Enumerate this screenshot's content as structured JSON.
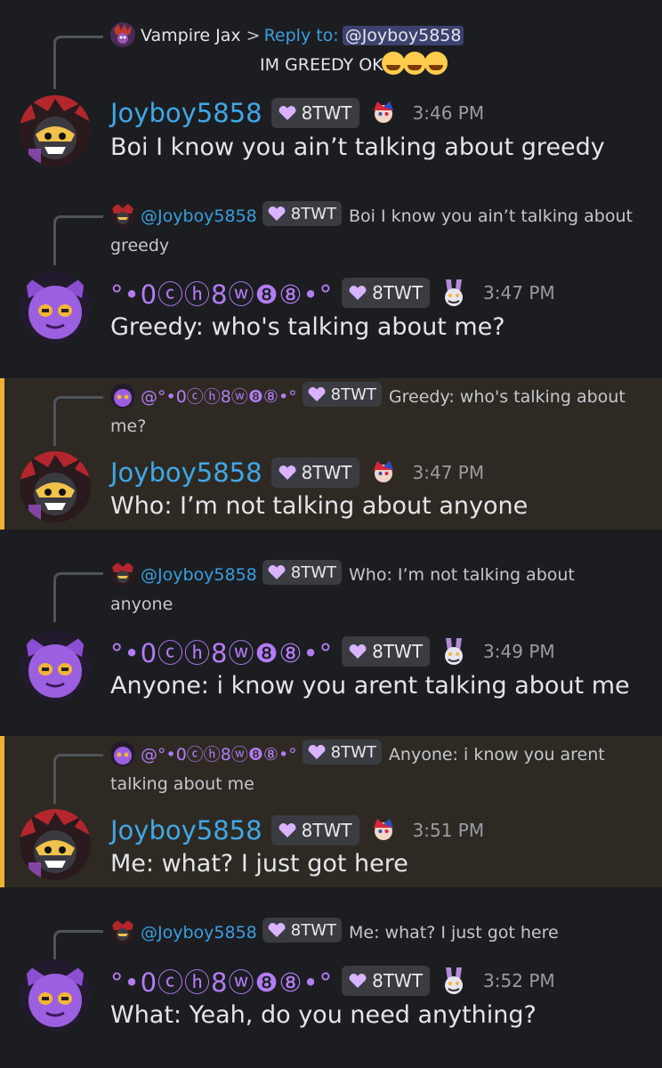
{
  "messages": [
    {
      "reply": {
        "author": "Vampire Jax",
        "arrow": ">",
        "prefix": "Reply to:",
        "mention": "@Joyboy5858",
        "text": "IM GREEDY OK"
      },
      "author": "Joyboy5858",
      "tag": "8TWT",
      "time": "3:46 PM",
      "text": "Boi I know you ain’t talking about greedy",
      "highlighted": false
    },
    {
      "reply": {
        "author": "@Joyboy5858",
        "tag": "8TWT",
        "text": "Boi I know you ain’t talking about greedy"
      },
      "author": "°•0ⓒⓗ8ⓦ❽⑧•°",
      "tag": "8TWT",
      "time": "3:47 PM",
      "text": "Greedy: who's talking about me?",
      "highlighted": false
    },
    {
      "reply": {
        "author": "@°•0ⓒⓗ8ⓦ❽⑧•°",
        "tag": "8TWT",
        "text": "Greedy: who's talking about me?"
      },
      "author": "Joyboy5858",
      "tag": "8TWT",
      "time": "3:47 PM",
      "text": "Who: I’m not talking about anyone",
      "highlighted": true
    },
    {
      "reply": {
        "author": "@Joyboy5858",
        "tag": "8TWT",
        "text": "Who: I’m not talking about anyone"
      },
      "author": "°•0ⓒⓗ8ⓦ❽⑧•°",
      "tag": "8TWT",
      "time": "3:49 PM",
      "text": "Anyone: i know you arent talking about me",
      "highlighted": false
    },
    {
      "reply": {
        "author": "@°•0ⓒⓗ8ⓦ❽⑧•°",
        "tag": "8TWT",
        "text": "Anyone: i know you arent talking about me"
      },
      "author": "Joyboy5858",
      "tag": "8TWT",
      "time": "3:51 PM",
      "text": "Me: what? I just got here",
      "highlighted": true
    },
    {
      "reply": {
        "author": "@Joyboy5858",
        "tag": "8TWT",
        "text": "Me: what? I just got here"
      },
      "author": "°•0ⓒⓗ8ⓦ❽⑧•°",
      "tag": "8TWT",
      "time": "3:52 PM",
      "text": "What: Yeah, do you need anything?",
      "highlighted": false
    }
  ],
  "colors": {
    "background": "#1c1d21",
    "highlight_bg": "#2e2a23",
    "highlight_bar": "#f0b232",
    "mention_blue": "#3fa8e8",
    "username_purple": "#b37cf5",
    "timestamp": "#9a9ca2"
  },
  "icons": {
    "joyboy_avatar": "red-black-character-avatar",
    "purple_avatar": "purple-cat-character-avatar",
    "pomni_role_icon": "jester-role-icon",
    "jax_role_icon": "rabbit-role-icon",
    "tag_icon": "purple-heart-icon",
    "emoji": "loudly-crying-face-emoji"
  }
}
